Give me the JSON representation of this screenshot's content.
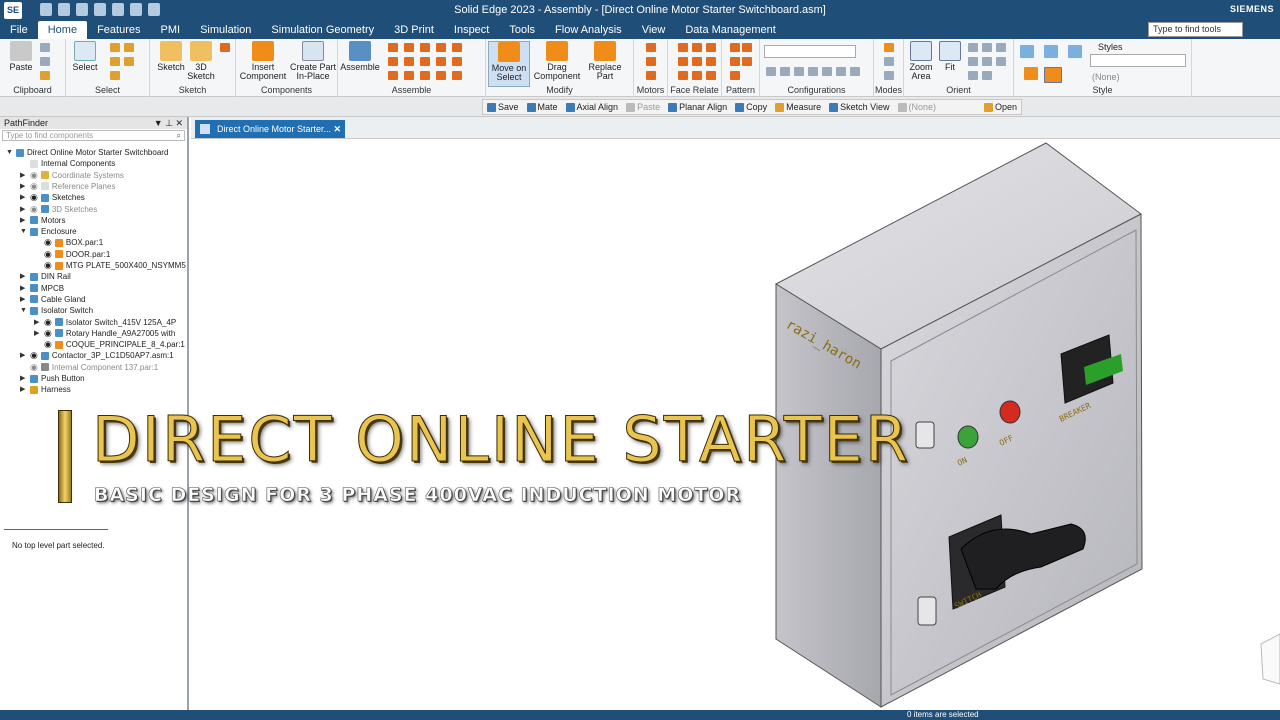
{
  "app": {
    "logo": "SE",
    "title": "Solid Edge 2023 - Assembly - [Direct Online Motor Starter Switchboard.asm]",
    "brand": "SIEMENS"
  },
  "menu": {
    "items": [
      "File",
      "Home",
      "Features",
      "PMI",
      "Simulation",
      "Simulation Geometry",
      "3D Print",
      "Inspect",
      "Tools",
      "Flow Analysis",
      "View",
      "Data Management"
    ],
    "active": "Home",
    "search_placeholder": "Type to find tools"
  },
  "ribbon": {
    "groups": [
      {
        "label": "Clipboard",
        "buttons": [
          "Paste"
        ]
      },
      {
        "label": "Select",
        "buttons": [
          "Select"
        ]
      },
      {
        "label": "Sketch",
        "buttons": [
          "Sketch",
          "3D Sketch"
        ]
      },
      {
        "label": "Components",
        "buttons": [
          "Insert Component",
          "Create Part In-Place"
        ]
      },
      {
        "label": "Assemble",
        "buttons": [
          "Assemble"
        ]
      },
      {
        "label": "Modify",
        "buttons": [
          "Move on Select",
          "Drag Component",
          "Replace Part"
        ]
      },
      {
        "label": "Motors",
        "buttons": []
      },
      {
        "label": "Face Relate",
        "buttons": []
      },
      {
        "label": "Pattern",
        "buttons": []
      },
      {
        "label": "Configurations",
        "buttons": []
      },
      {
        "label": "Modes",
        "buttons": []
      },
      {
        "label": "Orient",
        "buttons": [
          "Zoom Area",
          "Fit"
        ]
      },
      {
        "label": "Style",
        "buttons": []
      }
    ],
    "styles_label": "Styles",
    "style_value": "(None)"
  },
  "commandbar": {
    "items": [
      "Save",
      "Mate",
      "Axial Align",
      "Paste",
      "Planar Align",
      "Copy",
      "Measure",
      "Sketch View",
      "(None)",
      "Open"
    ]
  },
  "pathfinder": {
    "title": "PathFinder",
    "search_placeholder": "Type to find components",
    "tree": [
      {
        "label": "Direct Online Motor Starter Switchboard",
        "level": 0,
        "expand": "▼",
        "dim": false,
        "eye": false,
        "color": "#4a90c8"
      },
      {
        "label": "Internal Components",
        "level": 1,
        "expand": "",
        "dim": false,
        "eye": false,
        "color": "#dddddd"
      },
      {
        "label": "Coordinate Systems",
        "level": 1,
        "expand": "▶",
        "dim": true,
        "eye": true,
        "color": "#e0b040"
      },
      {
        "label": "Reference Planes",
        "level": 1,
        "expand": "▶",
        "dim": true,
        "eye": true,
        "color": "#dddddd"
      },
      {
        "label": "Sketches",
        "level": 1,
        "expand": "▶",
        "dim": false,
        "eye": true,
        "color": "#4a90c8"
      },
      {
        "label": "3D Sketches",
        "level": 1,
        "expand": "▶",
        "dim": true,
        "eye": true,
        "color": "#4a90c8"
      },
      {
        "label": "Motors",
        "level": 1,
        "expand": "▶",
        "dim": false,
        "eye": false,
        "color": "#4a90c8"
      },
      {
        "label": "Enclosure",
        "level": 1,
        "expand": "▼",
        "dim": false,
        "eye": false,
        "color": "#4a90c8"
      },
      {
        "label": "BOX.par:1",
        "level": 2,
        "expand": "",
        "dim": false,
        "eye": true,
        "color": "#f08c1a"
      },
      {
        "label": "DOOR.par:1",
        "level": 2,
        "expand": "",
        "dim": false,
        "eye": true,
        "color": "#f08c1a"
      },
      {
        "label": "MTG PLATE_500X400_NSYMM5",
        "level": 2,
        "expand": "",
        "dim": false,
        "eye": true,
        "color": "#f08c1a"
      },
      {
        "label": "DIN Rail",
        "level": 1,
        "expand": "▶",
        "dim": false,
        "eye": false,
        "color": "#4a90c8"
      },
      {
        "label": "MPCB",
        "level": 1,
        "expand": "▶",
        "dim": false,
        "eye": false,
        "color": "#4a90c8"
      },
      {
        "label": "Cable Gland",
        "level": 1,
        "expand": "▶",
        "dim": false,
        "eye": false,
        "color": "#4a90c8"
      },
      {
        "label": "Isolator Switch",
        "level": 1,
        "expand": "▼",
        "dim": false,
        "eye": false,
        "color": "#4a90c8"
      },
      {
        "label": "Isolator Switch_415V 125A_4P",
        "level": 2,
        "expand": "▶",
        "dim": false,
        "eye": true,
        "color": "#4a90c8"
      },
      {
        "label": "Rotary Handle_A9A27005 with",
        "level": 2,
        "expand": "▶",
        "dim": false,
        "eye": true,
        "color": "#4a90c8"
      },
      {
        "label": "COQUE_PRINCIPALE_8_4.par:1",
        "level": 2,
        "expand": "",
        "dim": false,
        "eye": true,
        "color": "#f08c1a"
      },
      {
        "label": "Contactor_3P_LC1D50AP7.asm:1",
        "level": 1,
        "expand": "▶",
        "dim": false,
        "eye": true,
        "color": "#4a90c8"
      },
      {
        "label": "Internal Component 137.par:1",
        "level": 1,
        "expand": "",
        "dim": true,
        "eye": true,
        "color": "#888888"
      },
      {
        "label": "Push Button",
        "level": 1,
        "expand": "▶",
        "dim": false,
        "eye": false,
        "color": "#4a90c8"
      },
      {
        "label": "Harness",
        "level": 1,
        "expand": "▶",
        "dim": false,
        "eye": false,
        "color": "#e0a020"
      }
    ],
    "status": "No top level part selected."
  },
  "doc_tab": {
    "label": "Direct Online Motor Starter...",
    "close": "✕"
  },
  "model": {
    "author_tag": "razi_haron",
    "on_label": "ON",
    "off_label": "OFF",
    "breaker_label": "BREAKER",
    "switch_label": "SWITCH",
    "lamp_on_color": "#3aa33a",
    "lamp_off_color": "#d42a1f"
  },
  "overlay": {
    "title": "DIRECT ONLINE STARTER",
    "subtitle": "BASIC DESIGN FOR 3 PHASE 400VAC INDUCTION MOTOR"
  },
  "statusbar": {
    "text": "0 items are selected"
  },
  "colors": {
    "chrome": "#1f4e79",
    "accent": "#1f6fb2",
    "gold": "#e9c54f"
  }
}
